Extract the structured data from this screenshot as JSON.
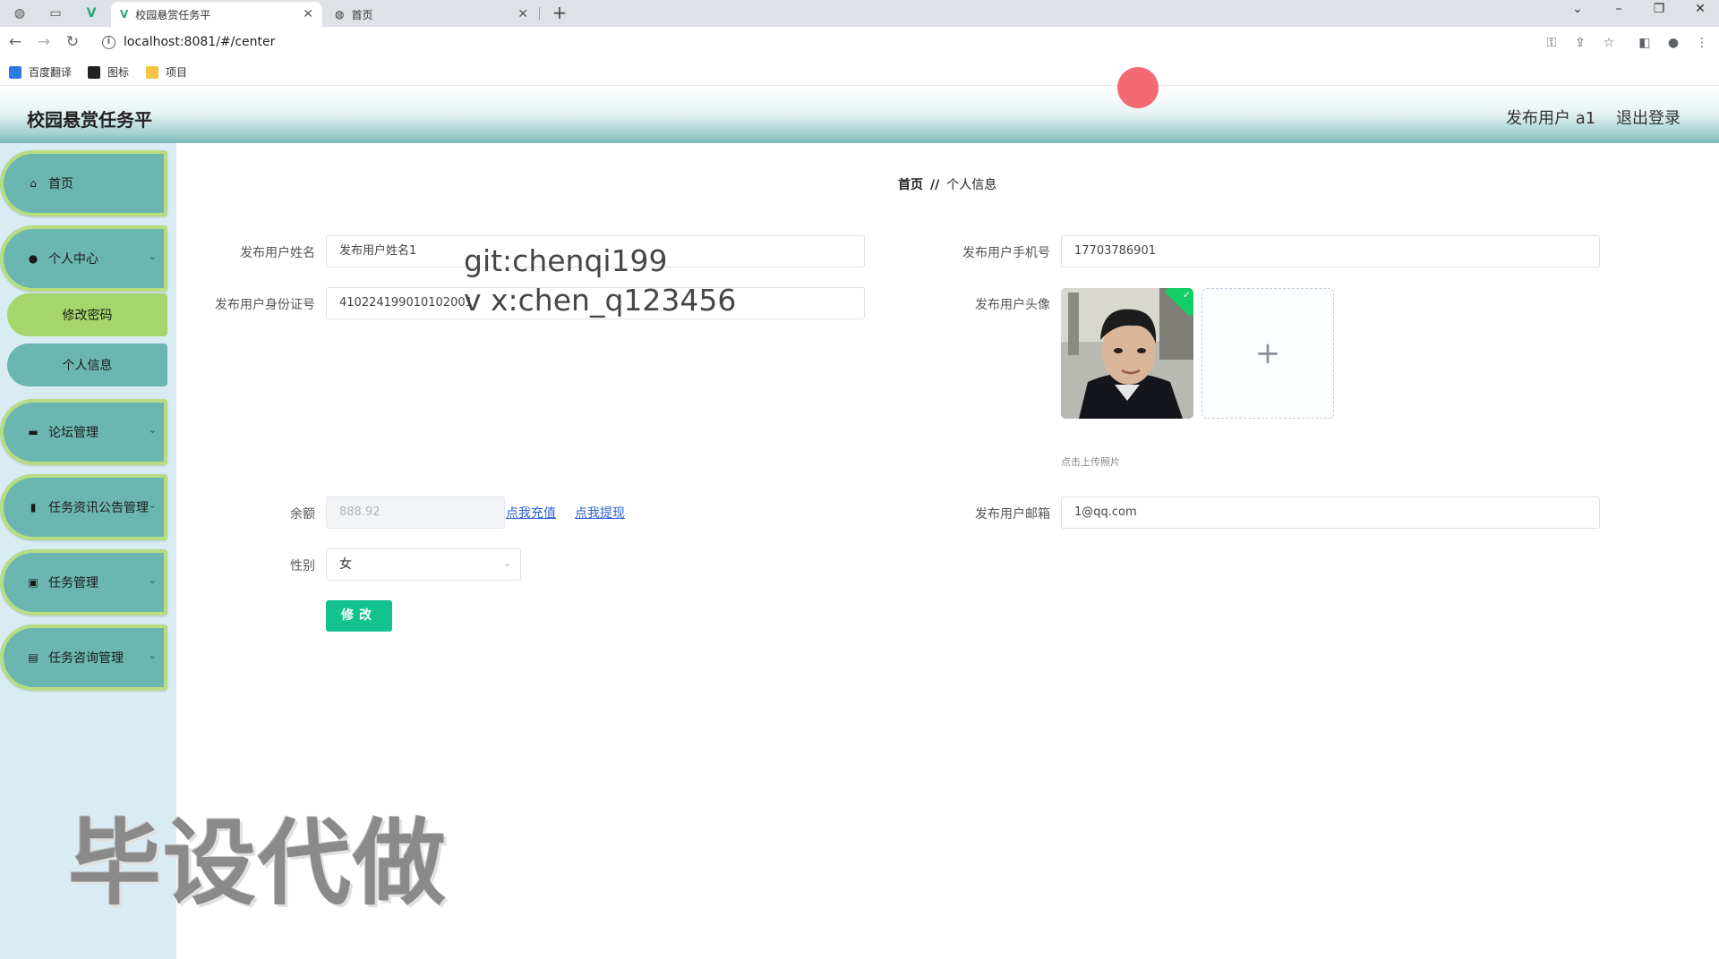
{
  "browser": {
    "tabs": [
      {
        "title": "校园悬赏任务平",
        "active": true
      },
      {
        "title": "首页",
        "active": false
      }
    ],
    "url": "localhost:8081/#/center",
    "bookmarks": [
      {
        "label": "百度翻译",
        "icon": "translate-icon"
      },
      {
        "label": "图标",
        "icon": "image-icon"
      },
      {
        "label": "项目",
        "icon": "folder-icon"
      }
    ]
  },
  "header": {
    "title": "校园悬赏任务平",
    "user": "发布用户 a1",
    "logout": "退出登录"
  },
  "sidebar": {
    "items": [
      {
        "label": "首页",
        "icon": "home-icon"
      },
      {
        "label": "个人中心",
        "icon": "user-icon",
        "expanded": true,
        "children": [
          {
            "label": "修改密码"
          },
          {
            "label": "个人信息"
          }
        ]
      },
      {
        "label": "论坛管理",
        "icon": "monitor-icon"
      },
      {
        "label": "任务资讯公告管理",
        "icon": "bar-chart-icon"
      },
      {
        "label": "任务管理",
        "icon": "briefcase-icon"
      },
      {
        "label": "任务咨询管理",
        "icon": "book-icon"
      }
    ]
  },
  "breadcrumb": {
    "home": "首页",
    "separator": "//",
    "current": "个人信息"
  },
  "form": {
    "name": {
      "label": "发布用户姓名",
      "value": "发布用户姓名1"
    },
    "phone": {
      "label": "发布用户手机号",
      "value": "17703786901"
    },
    "id_card": {
      "label": "发布用户身份证号",
      "value": "410224199010102001"
    },
    "avatar": {
      "label": "发布用户头像",
      "upload_tip": "点击上传照片",
      "upload_plus": "+"
    },
    "balance": {
      "label": "余额",
      "value": "888.92",
      "recharge": "点我充值",
      "withdraw": "点我提现"
    },
    "email": {
      "label": "发布用户邮箱",
      "value": "1@qq.com"
    },
    "gender": {
      "label": "性别",
      "value": "女"
    },
    "submit": "修改"
  },
  "watermarks": {
    "git": "git:chenqi199",
    "wx": "v x:chen_q123456",
    "big": "毕设代做"
  },
  "colors": {
    "menu_bg": "#6bb6b1",
    "menu_border": "#b7dd80",
    "submenu_active": "#a5d66c",
    "sidebar_bg": "#d9ecf3",
    "submit_bg": "#13c38e"
  }
}
